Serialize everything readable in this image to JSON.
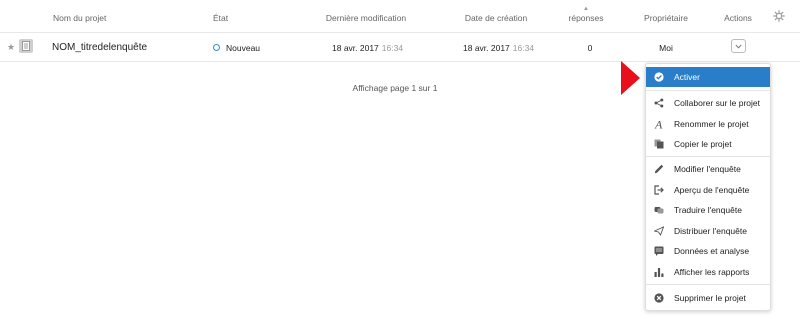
{
  "table": {
    "headers": {
      "name": "Nom du projet",
      "status": "État",
      "modified": "Dernière modification",
      "created": "Date de création",
      "responses": "réponses",
      "owner": "Propriétaire",
      "actions": "Actions"
    },
    "sort_icon": "sort-up-icon",
    "settings_icon": "gear-icon",
    "rows": [
      {
        "name": "NOM_titredelenquête",
        "status": "Nouveau",
        "modified_date": "18 avr. 2017",
        "modified_time": "16:34",
        "created_date": "18 avr. 2017",
        "created_time": "16:34",
        "responses": "0",
        "owner": "Moi"
      }
    ],
    "pagination": "Affichage page 1 sur 1"
  },
  "colors": {
    "active_item": "#2a7ec9",
    "status_new": "#2f8ed8",
    "pointer_arrow": "#e8101a"
  },
  "actions_menu": {
    "items": [
      {
        "label": "Activer",
        "icon": "check-circle-icon",
        "active": true
      },
      {
        "label": "Collaborer sur le projet",
        "icon": "share-icon"
      },
      {
        "label": "Renommer le projet",
        "icon": "rename-icon"
      },
      {
        "label": "Copier le projet",
        "icon": "copy-icon"
      },
      {
        "label": "Modifier l'enquête",
        "icon": "pencil-icon"
      },
      {
        "label": "Aperçu de l'enquête",
        "icon": "preview-icon"
      },
      {
        "label": "Traduire l'enquête",
        "icon": "translate-icon"
      },
      {
        "label": "Distribuer l'enquête",
        "icon": "send-icon"
      },
      {
        "label": "Données et analyse",
        "icon": "data-icon"
      },
      {
        "label": "Afficher les rapports",
        "icon": "bar-chart-icon"
      },
      {
        "label": "Supprimer le projet",
        "icon": "delete-icon"
      }
    ]
  }
}
